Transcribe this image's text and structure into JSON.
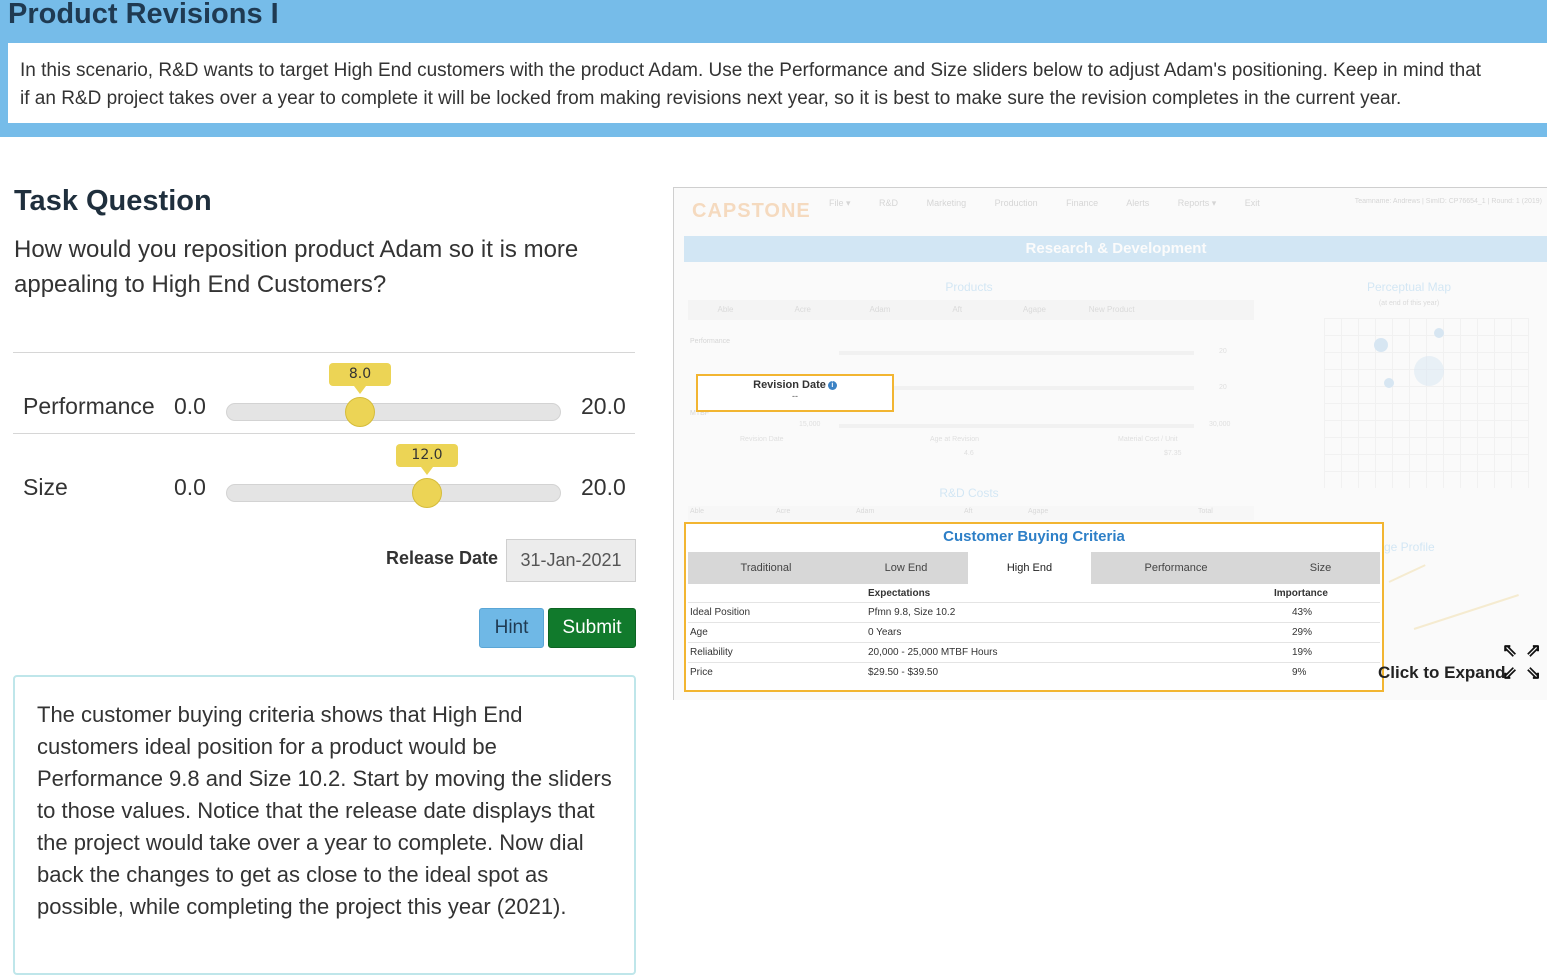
{
  "header": {
    "title": "Product Revisions I",
    "description_line1": "In this scenario, R&D wants to target High End customers with the product Adam. Use the Performance and Size sliders below to adjust Adam's positioning. Keep in mind that",
    "description_line2": "if an R&D project takes over a year to complete it will be locked from making revisions next year, so it is best to make sure the revision completes in the current year."
  },
  "task": {
    "title": "Task Question",
    "question": "How would you reposition product Adam so it is more appealing to High End Customers?"
  },
  "sliders": [
    {
      "label": "Performance",
      "min": "0.0",
      "max": "20.0",
      "value": "8.0",
      "fraction": 0.4
    },
    {
      "label": "Size",
      "min": "0.0",
      "max": "20.0",
      "value": "12.0",
      "fraction": 0.6
    }
  ],
  "release": {
    "label": "Release Date",
    "value": "31-Jan-2021"
  },
  "buttons": {
    "hint": "Hint",
    "submit": "Submit"
  },
  "hint_text": "The customer buying criteria shows that High End customers ideal position for a product would be Performance 9.8 and Size 10.2. Start by moving the sliders to those values. Notice that the release date displays that the project would take over a year to complete. Now dial back the changes to get as close to the ideal spot as possible, while completing the project this year (2021).",
  "screenshot": {
    "logo": "CAPSTONE",
    "nav": [
      "File ▾",
      "R&D",
      "Marketing",
      "Production",
      "Finance",
      "Alerts",
      "Reports ▾",
      "Exit"
    ],
    "team_info": "Teamname: Andrews | SimID: CP76654_1 | Round: 1 (2019)",
    "section_title": "Research & Development",
    "products_title": "Products",
    "product_tabs": [
      "Able",
      "Acre",
      "Adam",
      "Aft",
      "Agape",
      "New Product"
    ],
    "perf_label": "Performance",
    "mtbf_label": "MTBF",
    "rev_date_small": "Revision Date",
    "age_small": "Age at Revision",
    "age_val": "4.6",
    "cost_small": "Material Cost / Unit",
    "cost_val": "$7.35",
    "scale_max": "20",
    "mtbf_min": "15,000",
    "mtbf_max": "30,000",
    "perceptual_map_title": "Perceptual Map",
    "perceptual_map_sub": "(at end of this year)",
    "rd_costs_title": "R&D Costs",
    "cost_cols": [
      "Able",
      "Acre",
      "Adam",
      "Aft",
      "Agape",
      "Total"
    ],
    "age_profile_title": "ge Profile",
    "revision_box": {
      "title": "Revision Date",
      "value": "--"
    },
    "cbc": {
      "title": "Customer Buying Criteria",
      "tabs": [
        "Traditional",
        "Low End",
        "High End",
        "Performance",
        "Size"
      ],
      "active_tab": "High End",
      "col_expectations": "Expectations",
      "col_importance": "Importance",
      "rows": [
        {
          "criterion": "Ideal Position",
          "expectation": "Pfmn 9.8, Size 10.2",
          "importance": "43%"
        },
        {
          "criterion": "Age",
          "expectation": "0 Years",
          "importance": "29%"
        },
        {
          "criterion": "Reliability",
          "expectation": "20,000 - 25,000 MTBF Hours",
          "importance": "19%"
        },
        {
          "criterion": "Price",
          "expectation": "$29.50 - $39.50",
          "importance": "9%"
        }
      ]
    }
  },
  "expand": {
    "label": "Click to Expand"
  },
  "colors": {
    "banner": "#76bce9",
    "submit": "#117a2c",
    "hint": "#6fb8e6",
    "slider_thumb": "#ecd455",
    "highlight_border": "#f2b531"
  }
}
